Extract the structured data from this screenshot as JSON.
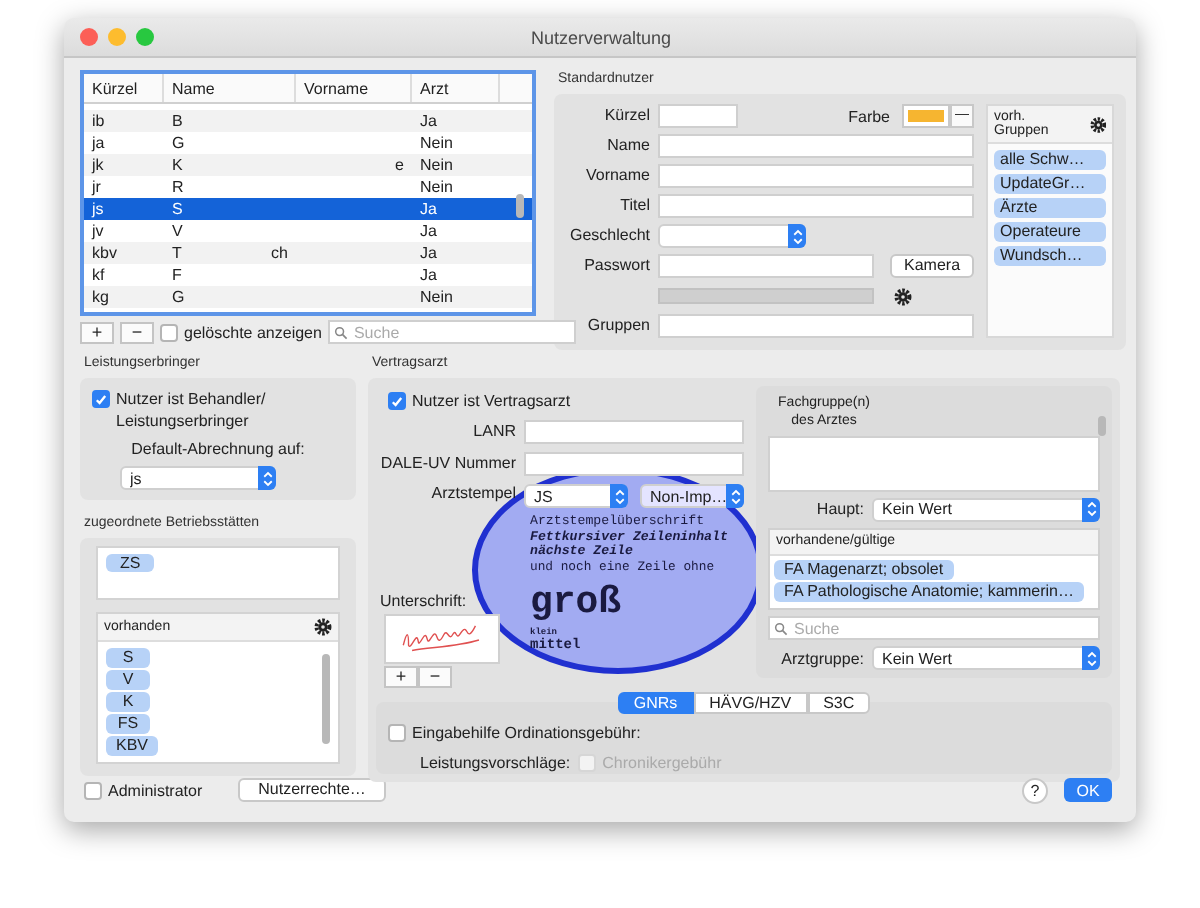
{
  "window": {
    "title": "Nutzerverwaltung"
  },
  "user_table": {
    "columns": [
      "Kürzel",
      "Name",
      "Vorname",
      "Arzt"
    ],
    "rows": [
      {
        "kuerzel": "ib",
        "name": "B",
        "arzt": "Ja",
        "selected": false
      },
      {
        "kuerzel": "ja",
        "name": "G",
        "arzt": "Nein",
        "selected": false
      },
      {
        "kuerzel": "jk",
        "name": "K",
        "vorname_tail": "e",
        "arzt": "Nein",
        "selected": false
      },
      {
        "kuerzel": "jr",
        "name": "R",
        "arzt": "Nein",
        "selected": false
      },
      {
        "kuerzel": "js",
        "name": "S",
        "arzt": "Ja",
        "selected": true
      },
      {
        "kuerzel": "jv",
        "name": "V",
        "arzt": "Ja",
        "selected": false
      },
      {
        "kuerzel": "kbv",
        "name": "T",
        "name_tail": "ch",
        "arzt": "Ja",
        "selected": false
      },
      {
        "kuerzel": "kf",
        "name": "F",
        "arzt": "Ja",
        "selected": false
      },
      {
        "kuerzel": "kg",
        "name": "G",
        "arzt": "Nein",
        "selected": false
      }
    ]
  },
  "table_controls": {
    "add": "+",
    "remove": "−",
    "show_deleted": {
      "label": "gelöschte anzeigen",
      "checked": false
    },
    "search": {
      "placeholder": "Suche"
    }
  },
  "standardnutzer": {
    "title": "Standardnutzer",
    "fields": [
      {
        "kind": "short",
        "label": "Kürzel"
      },
      {
        "kind": "text",
        "label": "Name"
      },
      {
        "kind": "text",
        "label": "Vorname"
      },
      {
        "kind": "text",
        "label": "Titel"
      },
      {
        "kind": "select",
        "label": "Geschlecht"
      },
      {
        "kind": "password",
        "label": "Passwort",
        "button": "Kamera"
      },
      {
        "kind": "text",
        "label": "Gruppen"
      }
    ],
    "farbe": {
      "label": "Farbe",
      "color": "#f6b530",
      "clear": "—"
    },
    "groups": {
      "title": "vorh. Gruppen",
      "items": [
        "alle Schw…",
        "UpdateGr…",
        "Ärzte",
        "Operateure",
        "Wundsch…"
      ]
    }
  },
  "leistungserbringer": {
    "title": "Leistungserbringer",
    "checkbox": {
      "label": "Nutzer ist Behandler/ Leistungserbringer",
      "checked": true
    },
    "default_label": "Default-Abrechnung auf:",
    "default_value": "js"
  },
  "betriebsstaetten": {
    "title": "zugeordnete Betriebsstätten",
    "assigned": [
      "ZS"
    ],
    "available": {
      "title": "vorhanden",
      "items": [
        "S",
        "V",
        "K",
        "FS",
        "KBV"
      ]
    }
  },
  "vertragsarzt": {
    "title": "Vertragsarzt",
    "checkbox": {
      "label": "Nutzer ist Vertragsarzt",
      "checked": true
    },
    "fields": [
      "LANR",
      "DALE-UV Nummer"
    ],
    "stamp": {
      "label": "Arztstempel",
      "select": "JS",
      "format": "Non-Imp…",
      "lines": [
        {
          "kind": "heading",
          "text": "Arztstempelüberschrift"
        },
        {
          "kind": "bolditalic",
          "text": "Fettkursiver Zeileninhalt"
        },
        {
          "kind": "bolditalic",
          "text": "nächste Zeile"
        },
        {
          "kind": "normal",
          "text": "und noch eine Zeile ohne"
        },
        {
          "kind": "large",
          "text": "groß"
        },
        {
          "kind": "small",
          "text": "klein"
        },
        {
          "kind": "medium",
          "text": "mittel"
        }
      ]
    },
    "signature": {
      "label": "Unterschrift:",
      "add": "+",
      "remove": "−"
    }
  },
  "fachgruppe": {
    "title": "Fachgruppe(n) des Arztes",
    "haupt_label": "Haupt:",
    "haupt_value": "Kein Wert",
    "list_title": "vorhandene/gültige",
    "items": [
      "FA Magenarzt; obsolet",
      "FA Pathologische Anatomie; kammerin…"
    ],
    "search": {
      "placeholder": "Suche"
    },
    "arztgruppe_label": "Arztgruppe:",
    "arztgruppe_value": "Kein Wert"
  },
  "tabs": [
    {
      "label": "GNRs",
      "selected": true
    },
    {
      "label": "HÄVG/HZV",
      "selected": false
    },
    {
      "label": "S3C",
      "selected": false
    }
  ],
  "ordination": {
    "checkbox": {
      "label": "Eingabehilfe Ordinationsgebühr:",
      "checked": false
    },
    "suggest_label": "Leistungsvorschläge:",
    "chroniker": {
      "label": "Chronikergebühr",
      "checked": false,
      "disabled": true
    }
  },
  "footer": {
    "admin": {
      "label": "Administrator",
      "checked": false
    },
    "rights_button": "Nutzerrechte…",
    "help": "?",
    "ok": "OK"
  }
}
